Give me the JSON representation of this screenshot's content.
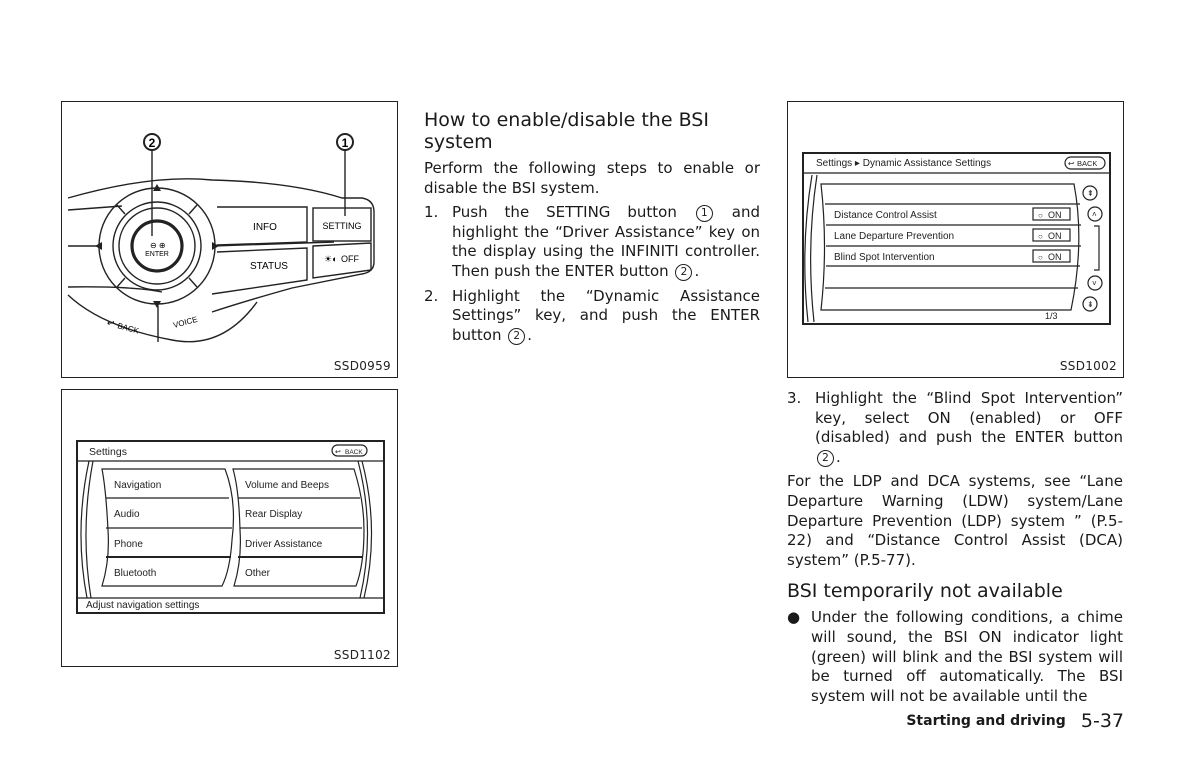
{
  "figures": {
    "controller": {
      "id": "SSD0959",
      "callout_1": "1",
      "callout_2": "2",
      "buttons": {
        "info": "INFO",
        "setting": "SETTING",
        "status": "STATUS",
        "display_off": "OFF",
        "enter": "ENTER",
        "back": "BACK",
        "voice": "VOICE"
      }
    },
    "settings_screen": {
      "id": "SSD1102",
      "title": "Settings",
      "back": "BACK",
      "left_items": [
        "Navigation",
        "Audio",
        "Phone",
        "Bluetooth"
      ],
      "right_items": [
        "Volume and Beeps",
        "Rear Display",
        "Driver Assistance",
        "Other"
      ],
      "status_text": "Adjust navigation settings"
    },
    "dynamic_screen": {
      "id": "SSD1002",
      "breadcrumb_root": "Settings",
      "breadcrumb_sep": "▸",
      "breadcrumb_current": "Dynamic Assistance Settings",
      "back": "BACK",
      "rows": [
        {
          "label": "Distance Control Assist",
          "state": "ON"
        },
        {
          "label": "Lane Departure Prevention",
          "state": "ON"
        },
        {
          "label": "Blind Spot Intervention",
          "state": "ON"
        }
      ],
      "page_indicator": "1/3"
    }
  },
  "middle": {
    "heading": "How to enable/disable the BSI system",
    "intro": "Perform the following steps to enable or disable the BSI system.",
    "step1": {
      "num": "1.",
      "a": "Push the SETTING button",
      "c1": "1",
      "b": "and highlight the “Driver Assistance” key on the display using the INFINITI controller. Then push the ENTER button",
      "c2": "2",
      "end": "."
    },
    "step2": {
      "num": "2.",
      "a": "Highlight the “Dynamic Assistance Settings” key, and push the ENTER button",
      "c2": "2",
      "end": "."
    }
  },
  "right": {
    "step3": {
      "num": "3.",
      "a": "Highlight the “Blind Spot Intervention” key, select ON (enabled) or OFF (disabled) and push the ENTER button",
      "c2": "2",
      "end": "."
    },
    "note": "For the LDP and DCA systems, see “Lane Departure Warning (LDW) system/Lane Departure Prevention (LDP) system ” (P.5-22) and “Distance Control Assist (DCA) system” (P.5-77).",
    "heading2": "BSI temporarily not available",
    "bullet": "Under the following conditions, a chime will sound, the BSI ON indicator light (green) will blink and the BSI system will be turned off automatically. The BSI system will not be available until the"
  },
  "footer": {
    "section": "Starting and driving",
    "page": "5-37"
  }
}
